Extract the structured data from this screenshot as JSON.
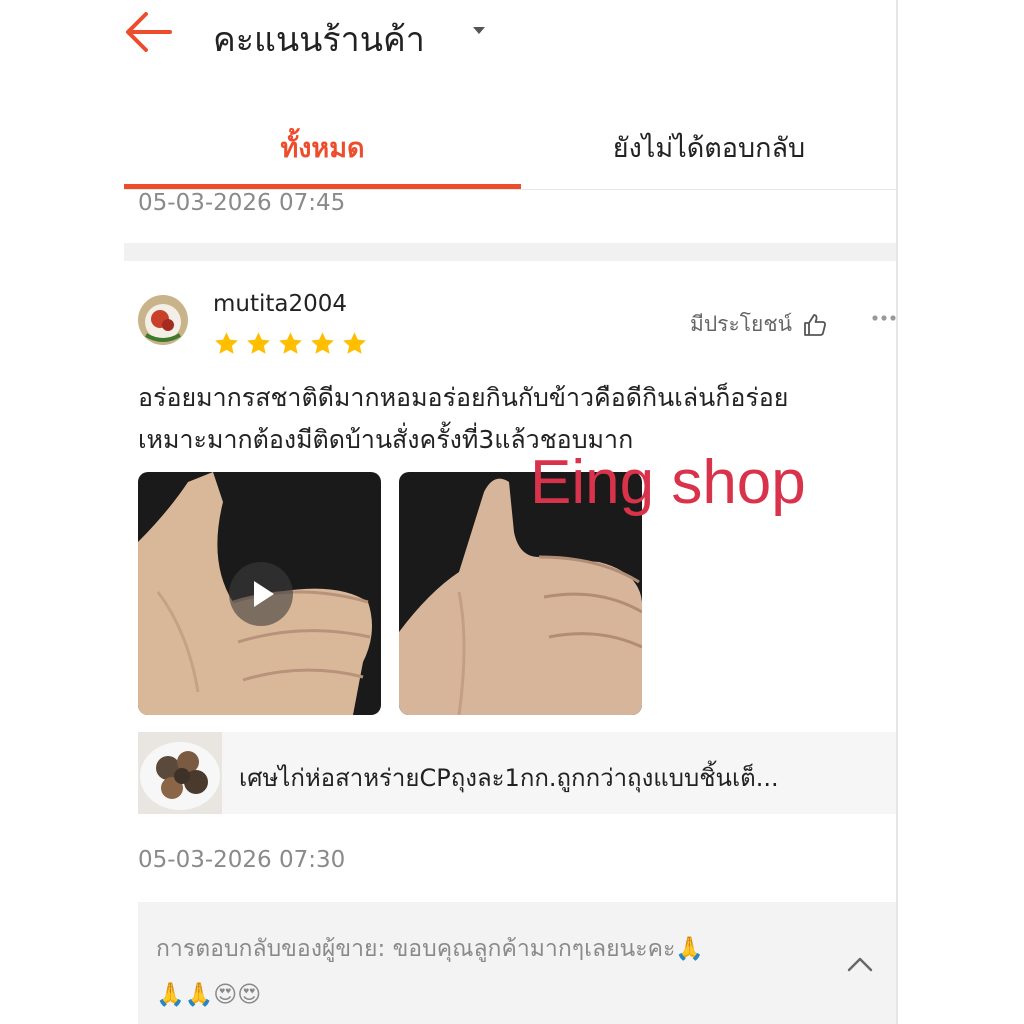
{
  "header": {
    "title": "คะแนนร้านค้า",
    "back_icon": "arrow-left-icon",
    "dropdown_icon": "caret-down-icon",
    "accent_color": "#ee4d2d"
  },
  "tabs": [
    {
      "label": "ทั้งหมด",
      "active": true
    },
    {
      "label": "ยังไม่ได้ตอบกลับ",
      "active": false
    }
  ],
  "previous_review": {
    "timestamp": "05-03-2026 07:45"
  },
  "review": {
    "username": "mutita2004",
    "rating": 5,
    "max_rating": 5,
    "helpful_label": "มีประโยชน์",
    "helpful_icon": "thumbs-up-icon",
    "more_icon": "more-dots-icon",
    "text_lines": [
      "อร่อยมากรสชาติดีมากหอมอร่อยกินกับข้าวคือดีกินเล่นก็อร่อย",
      "เหมาะมากต้องมีติดบ้านสั่งครั้งที่3แล้วชอบมาก"
    ],
    "media": [
      {
        "type": "video",
        "icon": "play-icon"
      },
      {
        "type": "image"
      }
    ],
    "product_name": "เศษไก่ห่อสาหร่ายCPถุงละ1กก.ถูกกว่าถุงแบบชิ้นเต็...",
    "timestamp": "05-03-2026 07:30",
    "seller_reply": {
      "line1": "การตอบกลับของผู้ขาย: ขอบคุณลูกค้ามากๆเลยนะคะ🙏",
      "line2": "🙏🙏😍😍",
      "toggle_icon": "chevron-up-icon"
    }
  },
  "watermark": "Eing shop"
}
